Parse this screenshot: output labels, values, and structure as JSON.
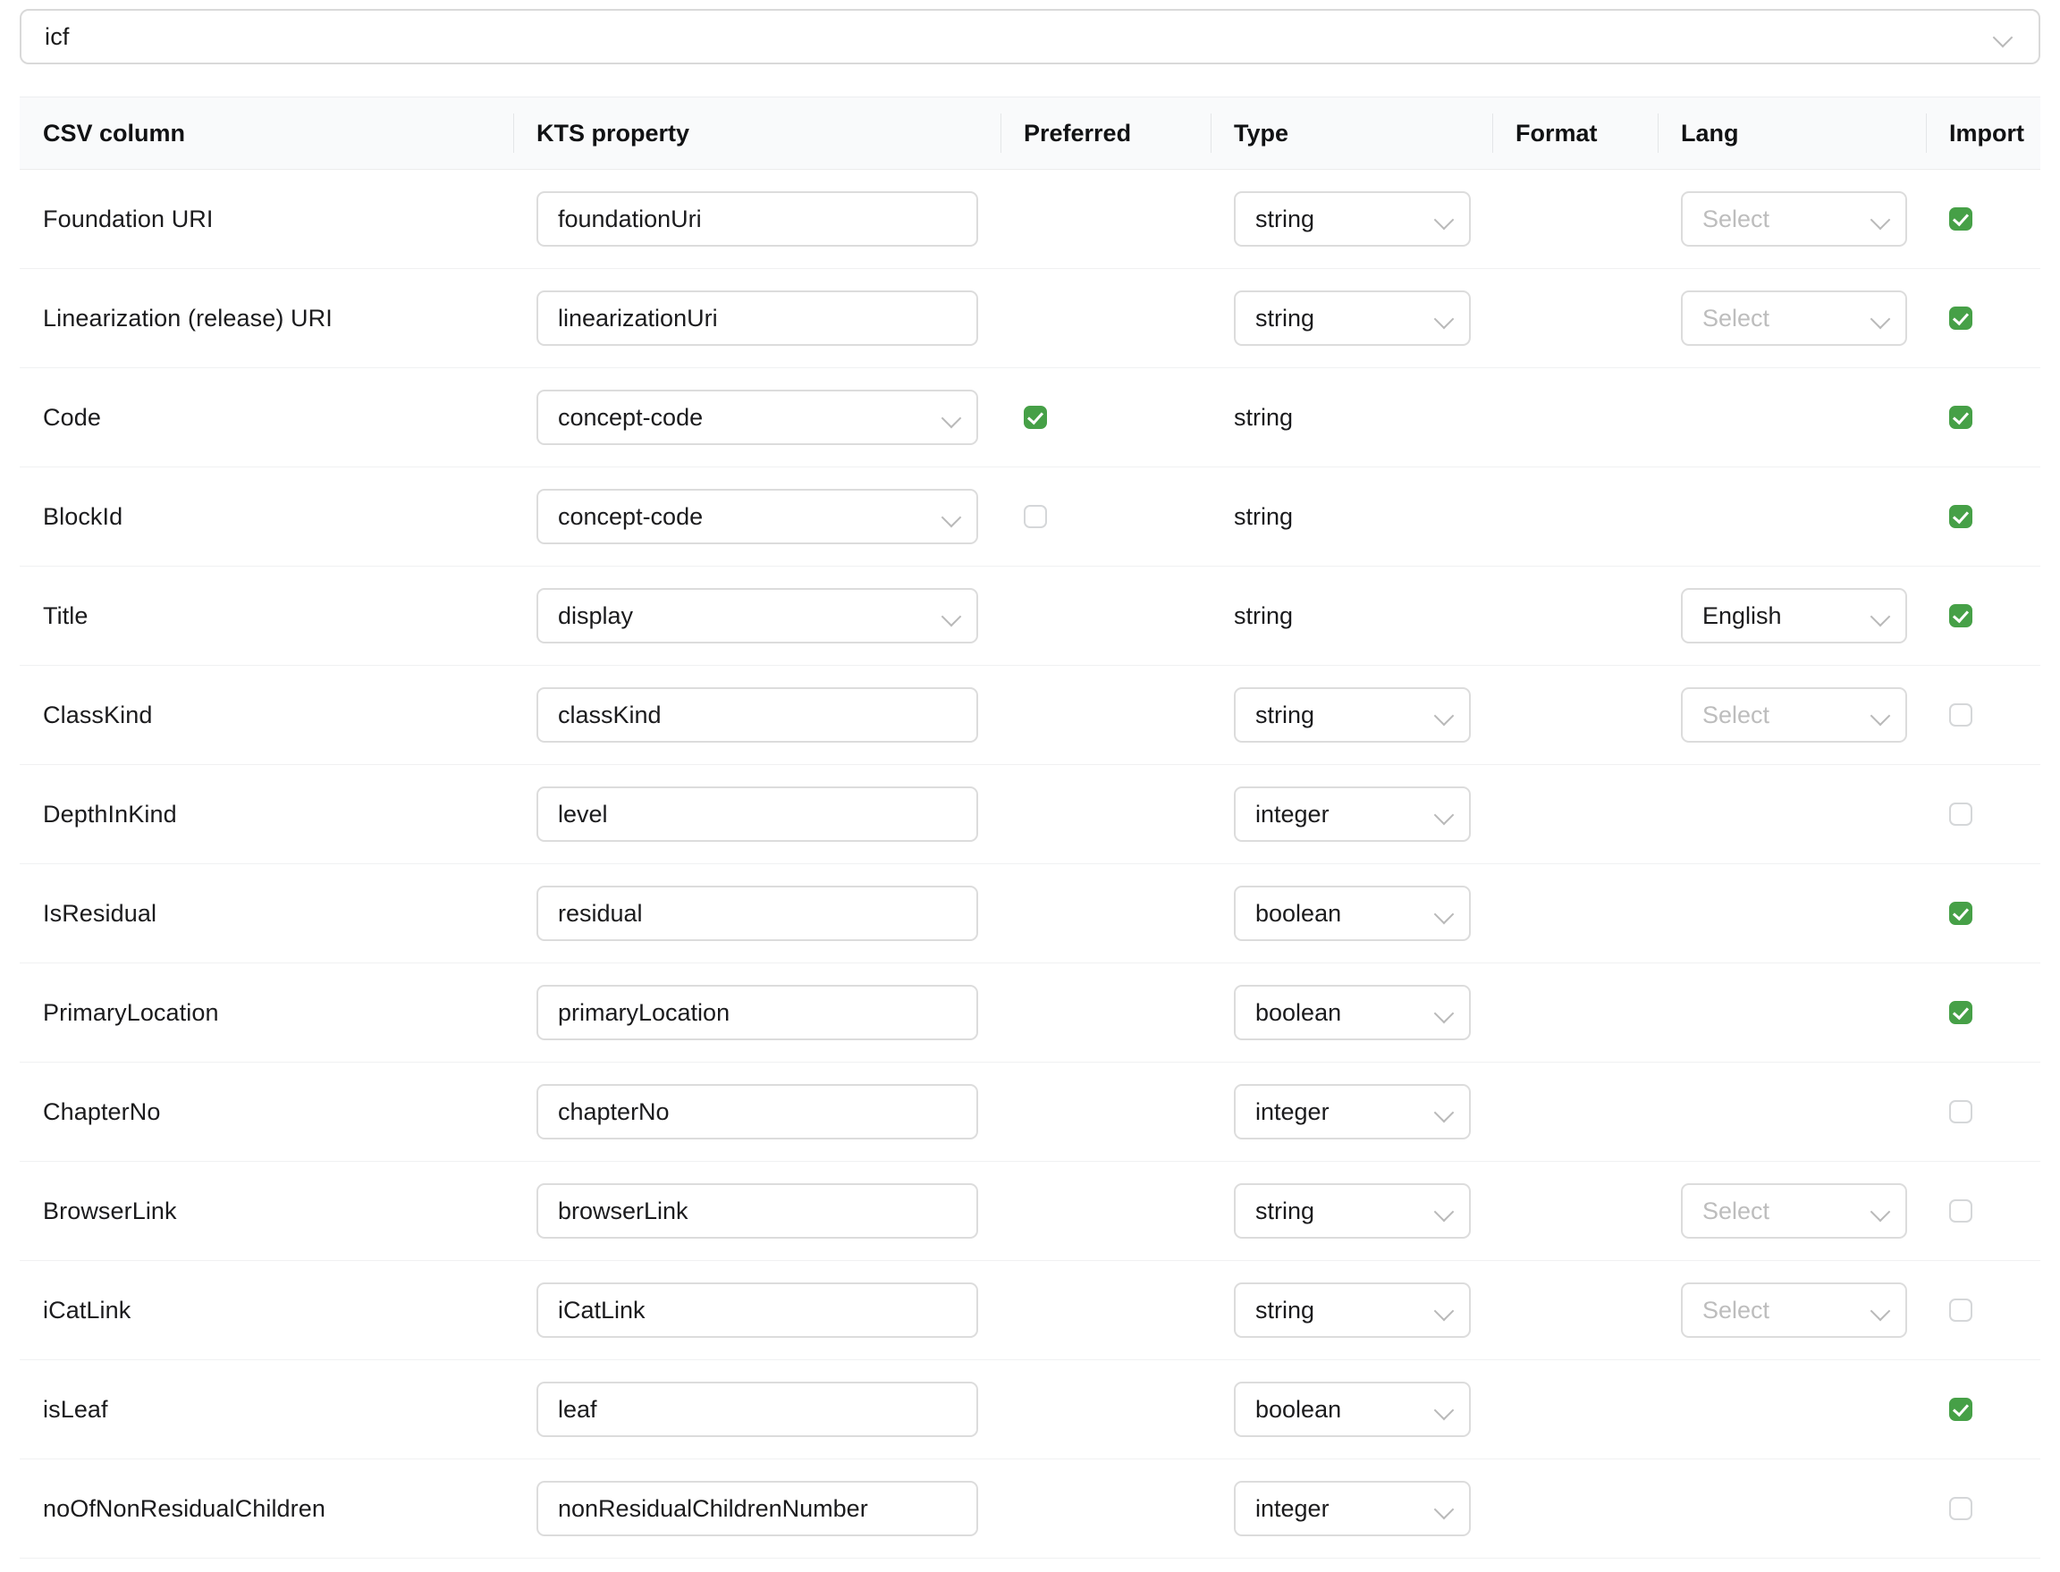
{
  "top_select": {
    "value": "icf",
    "placeholder": "Select",
    "chevron_icon": "chevron-down-icon"
  },
  "table": {
    "headers": {
      "csv_column": "CSV column",
      "kts_property": "KTS property",
      "preferred": "Preferred",
      "type": "Type",
      "format": "Format",
      "lang": "Lang",
      "import": "Import"
    },
    "lang_placeholder": "Select",
    "colors": {
      "checkbox_checked": "#46a047",
      "checkbox_border": "#d5d7d9",
      "header_background": "#f9fafb",
      "field_border": "#dcdcdc",
      "text": "#1b1b1d",
      "placeholder": "#bdbdbd"
    },
    "rows": [
      {
        "csv_column": "Foundation URI",
        "kts_property": "foundationUri",
        "kts_control": "text",
        "preferred": null,
        "type": "string",
        "type_control": "select",
        "format": "",
        "lang": "",
        "lang_control": "select",
        "import": true
      },
      {
        "csv_column": "Linearization (release) URI",
        "kts_property": "linearizationUri",
        "kts_control": "text",
        "preferred": null,
        "type": "string",
        "type_control": "select",
        "format": "",
        "lang": "",
        "lang_control": "select",
        "import": true
      },
      {
        "csv_column": "Code",
        "kts_property": "concept-code",
        "kts_control": "select",
        "preferred": true,
        "type": "string",
        "type_control": "text",
        "format": "",
        "lang": "",
        "lang_control": "none",
        "import": true
      },
      {
        "csv_column": "BlockId",
        "kts_property": "concept-code",
        "kts_control": "select",
        "preferred": false,
        "type": "string",
        "type_control": "text",
        "format": "",
        "lang": "",
        "lang_control": "none",
        "import": true
      },
      {
        "csv_column": "Title",
        "kts_property": "display",
        "kts_control": "select",
        "preferred": null,
        "type": "string",
        "type_control": "text",
        "format": "",
        "lang": "English",
        "lang_control": "select",
        "import": true
      },
      {
        "csv_column": "ClassKind",
        "kts_property": "classKind",
        "kts_control": "text",
        "preferred": null,
        "type": "string",
        "type_control": "select",
        "format": "",
        "lang": "",
        "lang_control": "select",
        "import": false
      },
      {
        "csv_column": "DepthInKind",
        "kts_property": "level",
        "kts_control": "text",
        "preferred": null,
        "type": "integer",
        "type_control": "select",
        "format": "",
        "lang": "",
        "lang_control": "none",
        "import": false
      },
      {
        "csv_column": "IsResidual",
        "kts_property": "residual",
        "kts_control": "text",
        "preferred": null,
        "type": "boolean",
        "type_control": "select",
        "format": "",
        "lang": "",
        "lang_control": "none",
        "import": true
      },
      {
        "csv_column": "PrimaryLocation",
        "kts_property": "primaryLocation",
        "kts_control": "text",
        "preferred": null,
        "type": "boolean",
        "type_control": "select",
        "format": "",
        "lang": "",
        "lang_control": "none",
        "import": true
      },
      {
        "csv_column": "ChapterNo",
        "kts_property": "chapterNo",
        "kts_control": "text",
        "preferred": null,
        "type": "integer",
        "type_control": "select",
        "format": "",
        "lang": "",
        "lang_control": "none",
        "import": false
      },
      {
        "csv_column": "BrowserLink",
        "kts_property": "browserLink",
        "kts_control": "text",
        "preferred": null,
        "type": "string",
        "type_control": "select",
        "format": "",
        "lang": "",
        "lang_control": "select",
        "import": false
      },
      {
        "csv_column": "iCatLink",
        "kts_property": "iCatLink",
        "kts_control": "text",
        "preferred": null,
        "type": "string",
        "type_control": "select",
        "format": "",
        "lang": "",
        "lang_control": "select",
        "import": false
      },
      {
        "csv_column": "isLeaf",
        "kts_property": "leaf",
        "kts_control": "text",
        "preferred": null,
        "type": "boolean",
        "type_control": "select",
        "format": "",
        "lang": "",
        "lang_control": "none",
        "import": true
      },
      {
        "csv_column": "noOfNonResidualChildren",
        "kts_property": "nonResidualChildrenNumber",
        "kts_control": "text",
        "preferred": null,
        "type": "integer",
        "type_control": "select",
        "format": "",
        "lang": "",
        "lang_control": "none",
        "import": false
      }
    ]
  }
}
